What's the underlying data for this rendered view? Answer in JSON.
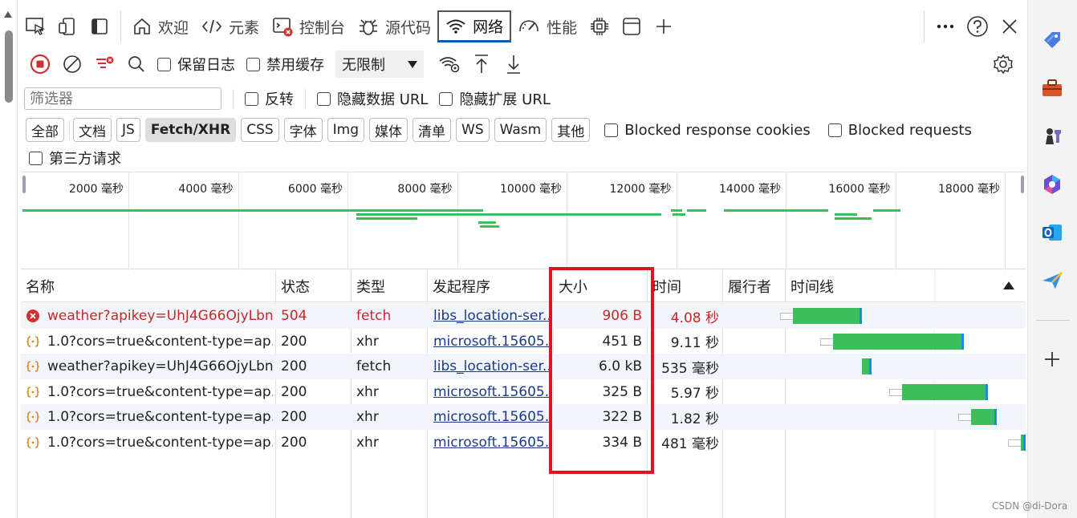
{
  "tabs": [
    {
      "label": "欢迎",
      "icon": "home-icon"
    },
    {
      "label": "元素",
      "icon": "code-icon"
    },
    {
      "label": "控制台",
      "icon": "console-icon"
    },
    {
      "label": "源代码",
      "icon": "bug-icon"
    },
    {
      "label": "网络",
      "icon": "wifi-icon",
      "active": true
    },
    {
      "label": "性能",
      "icon": "gauge-icon"
    }
  ],
  "toolbar": {
    "preserve_log": "保留日志",
    "disable_cache": "禁用缓存",
    "throttling": "无限制"
  },
  "filter": {
    "placeholder": "筛选器",
    "invert": "反转",
    "hide_data_urls": "隐藏数据 URL",
    "hide_ext_urls": "隐藏扩展 URL"
  },
  "type_filters": [
    "全部",
    "文档",
    "JS",
    "Fetch/XHR",
    "CSS",
    "字体",
    "Img",
    "媒体",
    "清单",
    "WS",
    "Wasm",
    "其他"
  ],
  "active_type_filter": "Fetch/XHR",
  "blocked_cookies": "Blocked response cookies",
  "blocked_requests": "Blocked requests",
  "third_party": "第三方请求",
  "overview_ticks": [
    "2000 毫秒",
    "4000 毫秒",
    "6000 毫秒",
    "8000 毫秒",
    "10000 毫秒",
    "12000 毫秒",
    "14000 毫秒",
    "16000 毫秒",
    "18000 毫秒"
  ],
  "columns": {
    "name": "名称",
    "status": "状态",
    "type": "类型",
    "initiator": "发起程序",
    "size": "大小",
    "time": "时间",
    "fulfilled_by": "履行者",
    "waterfall": "时间线"
  },
  "requests": [
    {
      "name": "weather?apikey=UhJ4G66OjyLbn...",
      "status": "504",
      "type": "fetch",
      "initiator": "libs_location-ser...",
      "size": "906 B",
      "time": "4.08 秒",
      "error": true,
      "icon": "error-icon",
      "bar_start": 0.02,
      "bar_len": 0.29
    },
    {
      "name": "1.0?cors=true&content-type=ap...",
      "status": "200",
      "type": "xhr",
      "initiator": "microsoft.15605...",
      "size": "451 B",
      "time": "9.11 秒",
      "error": false,
      "icon": "xhr-icon",
      "bar_start": 0.19,
      "bar_len": 0.55
    },
    {
      "name": "weather?apikey=UhJ4G66OjyLbn...",
      "status": "200",
      "type": "fetch",
      "initiator": "libs_location-ser...",
      "size": "6.0 kB",
      "time": "535 毫秒",
      "error": false,
      "icon": "xhr-icon",
      "bar_start": 0.31,
      "bar_len": 0.04
    },
    {
      "name": "1.0?cors=true&content-type=ap...",
      "status": "200",
      "type": "xhr",
      "initiator": "microsoft.15605...",
      "size": "325 B",
      "time": "5.97 秒",
      "error": false,
      "icon": "xhr-icon",
      "bar_start": 0.48,
      "bar_len": 0.36
    },
    {
      "name": "1.0?cors=true&content-type=ap...",
      "status": "200",
      "type": "xhr",
      "initiator": "microsoft.15605...",
      "size": "322 B",
      "time": "1.82 秒",
      "error": false,
      "icon": "xhr-icon",
      "bar_start": 0.77,
      "bar_len": 0.11
    },
    {
      "name": "1.0?cors=true&content-type=ap...",
      "status": "200",
      "type": "xhr",
      "initiator": "microsoft.15605...",
      "size": "334 B",
      "time": "481 毫秒",
      "error": false,
      "icon": "xhr-icon",
      "bar_start": 0.98,
      "bar_len": 0.02
    }
  ],
  "watermark": "CSDN @di-Dora",
  "colors": {
    "accent": "#0b5cad",
    "error": "#c62828",
    "bar": "#3cbf5a",
    "highlight": "#e0141d"
  }
}
